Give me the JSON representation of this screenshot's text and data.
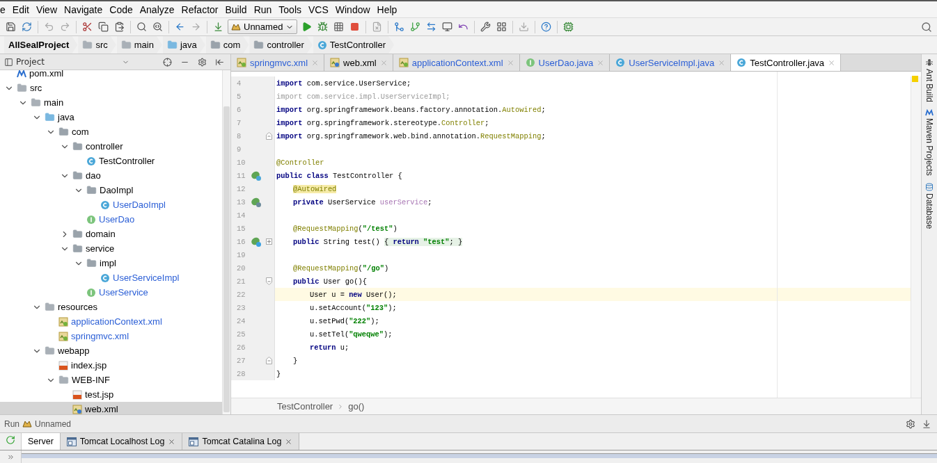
{
  "menu": [
    "e",
    "Edit",
    "View",
    "Navigate",
    "Code",
    "Analyze",
    "Refactor",
    "Build",
    "Run",
    "Tools",
    "VCS",
    "Window",
    "Help"
  ],
  "toolbar": {
    "run_config": "Unnamed"
  },
  "nav_bar": [
    {
      "label": "AllSealProject",
      "kind": "project"
    },
    {
      "label": "src",
      "kind": "folder"
    },
    {
      "label": "main",
      "kind": "folder"
    },
    {
      "label": "java",
      "kind": "source"
    },
    {
      "label": "com",
      "kind": "package"
    },
    {
      "label": "controller",
      "kind": "package"
    },
    {
      "label": "TestController",
      "kind": "class"
    }
  ],
  "project_panel": {
    "title": "Project",
    "tree": [
      {
        "label": "pom.xml",
        "kind": "maven",
        "vcs_new": false,
        "selected": false
      },
      {
        "label": "src",
        "kind": "folder",
        "expanded": true,
        "vcs_new": false,
        "selected": false,
        "children": [
          {
            "label": "main",
            "kind": "folder",
            "expanded": true,
            "vcs_new": false,
            "selected": false,
            "children": [
              {
                "label": "java",
                "kind": "source",
                "expanded": true,
                "vcs_new": false,
                "selected": false,
                "children": [
                  {
                    "label": "com",
                    "kind": "package",
                    "expanded": true,
                    "vcs_new": false,
                    "selected": false,
                    "children": [
                      {
                        "label": "controller",
                        "kind": "package",
                        "expanded": true,
                        "vcs_new": false,
                        "selected": false,
                        "children": [
                          {
                            "label": "TestController",
                            "kind": "class",
                            "vcs_new": false,
                            "selected": false
                          }
                        ]
                      },
                      {
                        "label": "dao",
                        "kind": "package",
                        "expanded": true,
                        "vcs_new": false,
                        "selected": false,
                        "children": [
                          {
                            "label": "DaoImpl",
                            "kind": "package",
                            "expanded": true,
                            "vcs_new": false,
                            "selected": false,
                            "children": [
                              {
                                "label": "UserDaoImpl",
                                "kind": "class",
                                "vcs_new": true,
                                "selected": false
                              }
                            ]
                          },
                          {
                            "label": "UserDao",
                            "kind": "interface",
                            "vcs_new": true,
                            "selected": false
                          }
                        ]
                      },
                      {
                        "label": "domain",
                        "kind": "package",
                        "expanded": false,
                        "vcs_new": false,
                        "selected": false
                      },
                      {
                        "label": "service",
                        "kind": "package",
                        "expanded": true,
                        "vcs_new": false,
                        "selected": false,
                        "children": [
                          {
                            "label": "impl",
                            "kind": "package",
                            "expanded": true,
                            "vcs_new": false,
                            "selected": false,
                            "children": [
                              {
                                "label": "UserServiceImpl",
                                "kind": "class",
                                "vcs_new": true,
                                "selected": false
                              }
                            ]
                          },
                          {
                            "label": "UserService",
                            "kind": "interface",
                            "vcs_new": true,
                            "selected": false
                          }
                        ]
                      }
                    ]
                  }
                ]
              },
              {
                "label": "resources",
                "kind": "resources",
                "expanded": true,
                "vcs_new": false,
                "selected": false,
                "children": [
                  {
                    "label": "applicationContext.xml",
                    "kind": "spring-xml",
                    "vcs_new": true,
                    "selected": false
                  },
                  {
                    "label": "springmvc.xml",
                    "kind": "spring-xml",
                    "vcs_new": true,
                    "selected": false
                  }
                ]
              },
              {
                "label": "webapp",
                "kind": "folder",
                "expanded": true,
                "vcs_new": false,
                "selected": false,
                "children": [
                  {
                    "label": "index.jsp",
                    "kind": "jsp",
                    "vcs_new": false,
                    "selected": false
                  },
                  {
                    "label": "WEB-INF",
                    "kind": "folder",
                    "expanded": true,
                    "vcs_new": false,
                    "selected": false,
                    "children": [
                      {
                        "label": "test.jsp",
                        "kind": "jsp",
                        "vcs_new": false,
                        "selected": false
                      },
                      {
                        "label": "web.xml",
                        "kind": "web-xml",
                        "vcs_new": false,
                        "selected": true
                      }
                    ]
                  }
                ]
              }
            ]
          }
        ]
      }
    ]
  },
  "editor_tabs": [
    {
      "label": "springmvc.xml",
      "kind": "spring-xml",
      "vcs_new": true,
      "selected": false
    },
    {
      "label": "web.xml",
      "kind": "web-xml",
      "vcs_new": false,
      "selected": false
    },
    {
      "label": "applicationContext.xml",
      "kind": "spring-xml",
      "vcs_new": true,
      "selected": false
    },
    {
      "label": "UserDao.java",
      "kind": "interface",
      "vcs_new": true,
      "selected": false
    },
    {
      "label": "UserServiceImpl.java",
      "kind": "class",
      "vcs_new": true,
      "selected": false
    },
    {
      "label": "TestController.java",
      "kind": "class",
      "vcs_new": false,
      "selected": true
    }
  ],
  "code_lines": [
    {
      "number": "4",
      "current": false,
      "tokens": [
        {
          "kind": "keyword",
          "text": "import"
        },
        {
          "kind": "plain",
          "text": " com.service.UserService;"
        }
      ]
    },
    {
      "number": "5",
      "current": false,
      "tokens": [
        {
          "kind": "unused",
          "text": "import com.service.impl.UserServiceImpl;"
        }
      ]
    },
    {
      "number": "6",
      "current": false,
      "tokens": [
        {
          "kind": "keyword",
          "text": "import"
        },
        {
          "kind": "plain",
          "text": " org.springframework.beans.factory.annotation."
        },
        {
          "kind": "reference",
          "text": "Autowired"
        },
        {
          "kind": "plain",
          "text": ";"
        }
      ]
    },
    {
      "number": "7",
      "current": false,
      "tokens": [
        {
          "kind": "keyword",
          "text": "import"
        },
        {
          "kind": "plain",
          "text": " org.springframework.stereotype."
        },
        {
          "kind": "reference",
          "text": "Controller"
        },
        {
          "kind": "plain",
          "text": ";"
        }
      ]
    },
    {
      "number": "8",
      "current": false,
      "fold_mark": {
        "kind": "end"
      },
      "tokens": [
        {
          "kind": "keyword",
          "text": "import"
        },
        {
          "kind": "plain",
          "text": " org.springframework.web.bind.annotation."
        },
        {
          "kind": "reference",
          "text": "RequestMapping"
        },
        {
          "kind": "plain",
          "text": ";"
        }
      ]
    },
    {
      "number": "9",
      "current": false
    },
    {
      "number": "10",
      "current": false,
      "tokens": [
        {
          "kind": "annotation",
          "text": "@Controller"
        }
      ]
    },
    {
      "number": "11",
      "current": false,
      "gutter_icon": {
        "kind": "bean-class"
      },
      "tokens": [
        {
          "kind": "keyword",
          "text": "public class"
        },
        {
          "kind": "plain",
          "text": " TestController {"
        }
      ],
      "children": [
        {
          "number": "12",
          "current": false,
          "tokens": [
            {
              "kind": "annotation-highlight",
              "text": "@Autowired"
            }
          ]
        },
        {
          "number": "13",
          "current": false,
          "gutter_icon": {
            "kind": "injected"
          },
          "tokens": [
            {
              "kind": "keyword",
              "text": "private"
            },
            {
              "kind": "plain",
              "text": " UserService "
            },
            {
              "kind": "field",
              "text": "userService"
            },
            {
              "kind": "plain",
              "text": ";"
            }
          ]
        },
        {
          "number": "14",
          "current": false
        },
        {
          "number": "15",
          "current": false,
          "tokens": [
            {
              "kind": "annotation",
              "text": "@RequestMapping"
            },
            {
              "kind": "plain",
              "text": "("
            },
            {
              "kind": "string",
              "text": "\"/test\""
            },
            {
              "kind": "plain",
              "text": ")"
            }
          ]
        },
        {
          "number": "16",
          "current": false,
          "gutter_icon": {
            "kind": "mapping"
          },
          "fold_mark": {
            "kind": "expand"
          },
          "tokens": [
            {
              "kind": "keyword",
              "text": "public"
            },
            {
              "kind": "plain",
              "text": " String test() "
            },
            {
              "kind": "folded-plain",
              "text": "{ "
            },
            {
              "kind": "folded-keyword",
              "text": "return"
            },
            {
              "kind": "folded-string",
              "text": " \"test\""
            },
            {
              "kind": "folded-plain",
              "text": "; }"
            }
          ]
        },
        {
          "number": "19",
          "current": false
        },
        {
          "number": "20",
          "current": false,
          "tokens": [
            {
              "kind": "annotation",
              "text": "@RequestMapping"
            },
            {
              "kind": "plain",
              "text": "("
            },
            {
              "kind": "string",
              "text": "\"/go\""
            },
            {
              "kind": "plain",
              "text": ")"
            }
          ]
        },
        {
          "number": "21",
          "current": false,
          "fold_mark": {
            "kind": "start"
          },
          "tokens": [
            {
              "kind": "keyword",
              "text": "public"
            },
            {
              "kind": "plain",
              "text": " User go(){"
            }
          ],
          "children": [
            {
              "number": "22",
              "current": true,
              "tokens": [
                {
                  "kind": "plain",
                  "text": "User u = "
                },
                {
                  "kind": "keyword",
                  "text": "new"
                },
                {
                  "kind": "plain",
                  "text": " User();"
                }
              ]
            },
            {
              "number": "23",
              "current": false,
              "tokens": [
                {
                  "kind": "plain",
                  "text": "u.setAccount("
                },
                {
                  "kind": "string",
                  "text": "\"123\""
                },
                {
                  "kind": "plain",
                  "text": ");"
                }
              ]
            },
            {
              "number": "24",
              "current": false,
              "tokens": [
                {
                  "kind": "plain",
                  "text": "u.setPwd("
                },
                {
                  "kind": "string",
                  "text": "\"222\""
                },
                {
                  "kind": "plain",
                  "text": ");"
                }
              ]
            },
            {
              "number": "25",
              "current": false,
              "tokens": [
                {
                  "kind": "plain",
                  "text": "u.setTel("
                },
                {
                  "kind": "string",
                  "text": "\"qweqwe\""
                },
                {
                  "kind": "plain",
                  "text": ");"
                }
              ]
            },
            {
              "number": "26",
              "current": false,
              "tokens": [
                {
                  "kind": "keyword",
                  "text": "return"
                },
                {
                  "kind": "plain",
                  "text": " u;"
                }
              ]
            }
          ]
        },
        {
          "number": "27",
          "current": false,
          "fold_mark": {
            "kind": "end"
          },
          "tokens": [
            {
              "kind": "plain",
              "text": "}"
            }
          ]
        }
      ]
    },
    {
      "number": "28",
      "current": false,
      "tokens": [
        {
          "kind": "plain",
          "text": "}"
        }
      ]
    }
  ],
  "editor_breadcrumb": [
    "TestController",
    "go()"
  ],
  "right_tool_windows": [
    {
      "label": "Ant Build",
      "kind": "ant"
    },
    {
      "label": "Maven Projects",
      "kind": "maven"
    },
    {
      "label": "Database",
      "kind": "database"
    }
  ],
  "run_panel": {
    "title": "Run",
    "config": "Unnamed",
    "tabs": [
      {
        "label": "Server",
        "kind": "server",
        "closable": false,
        "selected": true
      },
      {
        "label": "Tomcat Localhost Log",
        "kind": "log",
        "closable": true,
        "selected": false
      },
      {
        "label": "Tomcat Catalina Log",
        "kind": "log",
        "closable": true,
        "selected": false
      }
    ]
  }
}
